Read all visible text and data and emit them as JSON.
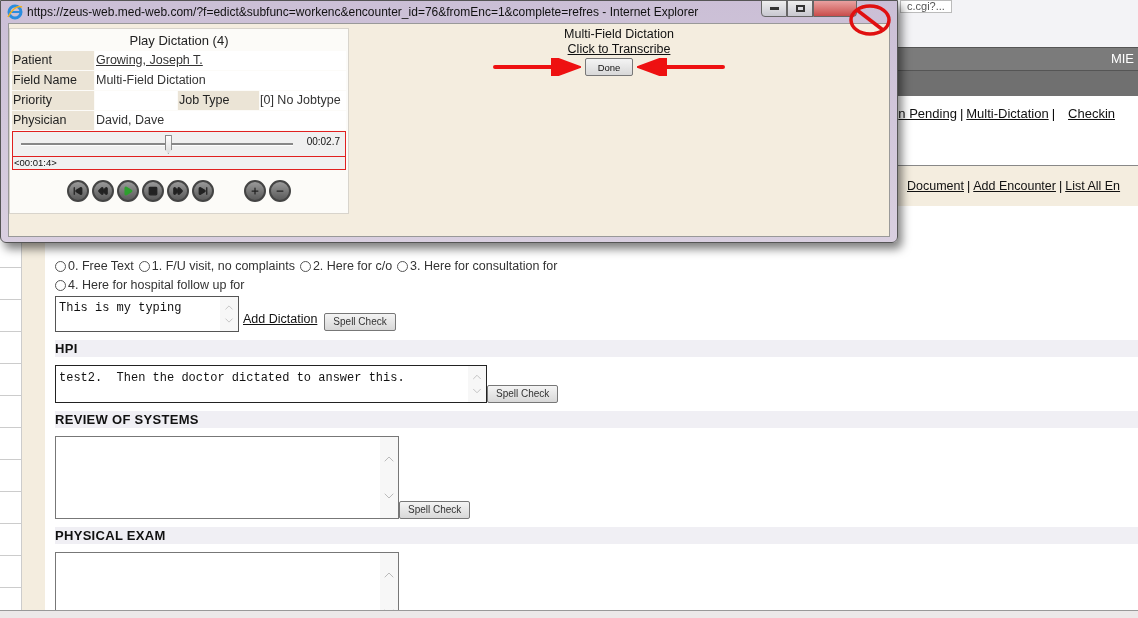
{
  "browser_tab": {
    "title": "c.cgi?..."
  },
  "page": {
    "header_bar": {
      "title": "MIE"
    },
    "link_separator": "|",
    "nav_links": [
      "n Pending",
      "Multi-Dictation",
      "Checkin"
    ],
    "action_links": [
      "Document",
      "Add Encounter",
      "List All En"
    ],
    "complaint": {
      "options": [
        {
          "label": "0. Free Text",
          "selected": false
        },
        {
          "label": "1. F/U visit, no complaints",
          "selected": false
        },
        {
          "label": "2. Here for c/o",
          "selected": false
        },
        {
          "label": "3. Here for consultation for",
          "selected": false
        },
        {
          "label": "4. Here for hospital follow up for",
          "selected": false
        }
      ],
      "text": "This is my typing",
      "add_link": "Add Dictation",
      "spell_button": "Spell Check"
    },
    "sections": [
      {
        "heading": "HPI",
        "text": "test2.  Then the doctor dictated to answer this.",
        "spell_button": "Spell Check",
        "kind": "short"
      },
      {
        "heading": "REVIEW OF SYSTEMS",
        "spell_button": "Spell Check",
        "kind": "tall"
      },
      {
        "heading": "PHYSICAL EXAM",
        "kind": "tall"
      }
    ]
  },
  "popup": {
    "title": "https://zeus-web.med-web.com/?f=edict&subfunc=workenc&encounter_id=76&fromEnc=1&complete=refres - Internet Explorer",
    "player": {
      "title": "Play Dictation (4)",
      "fields": [
        {
          "label": "Patient",
          "value": "Growing, Joseph T.",
          "kind": "link"
        },
        {
          "label": "Field Name",
          "value": "Multi-Field Dictation",
          "kind": "text"
        },
        {
          "label": "Priority",
          "kind": "pair",
          "label_2": "Job Type",
          "value_2": "[0] No Jobtype"
        },
        {
          "label": "Physician",
          "value": "David, Dave",
          "kind": "text"
        }
      ],
      "position": "00:02.7",
      "level": 0.54,
      "length": "<00:01:4>"
    },
    "dictation": {
      "title": "Multi-Field Dictation",
      "link": "Click to Transcribe",
      "button": "Done"
    }
  }
}
